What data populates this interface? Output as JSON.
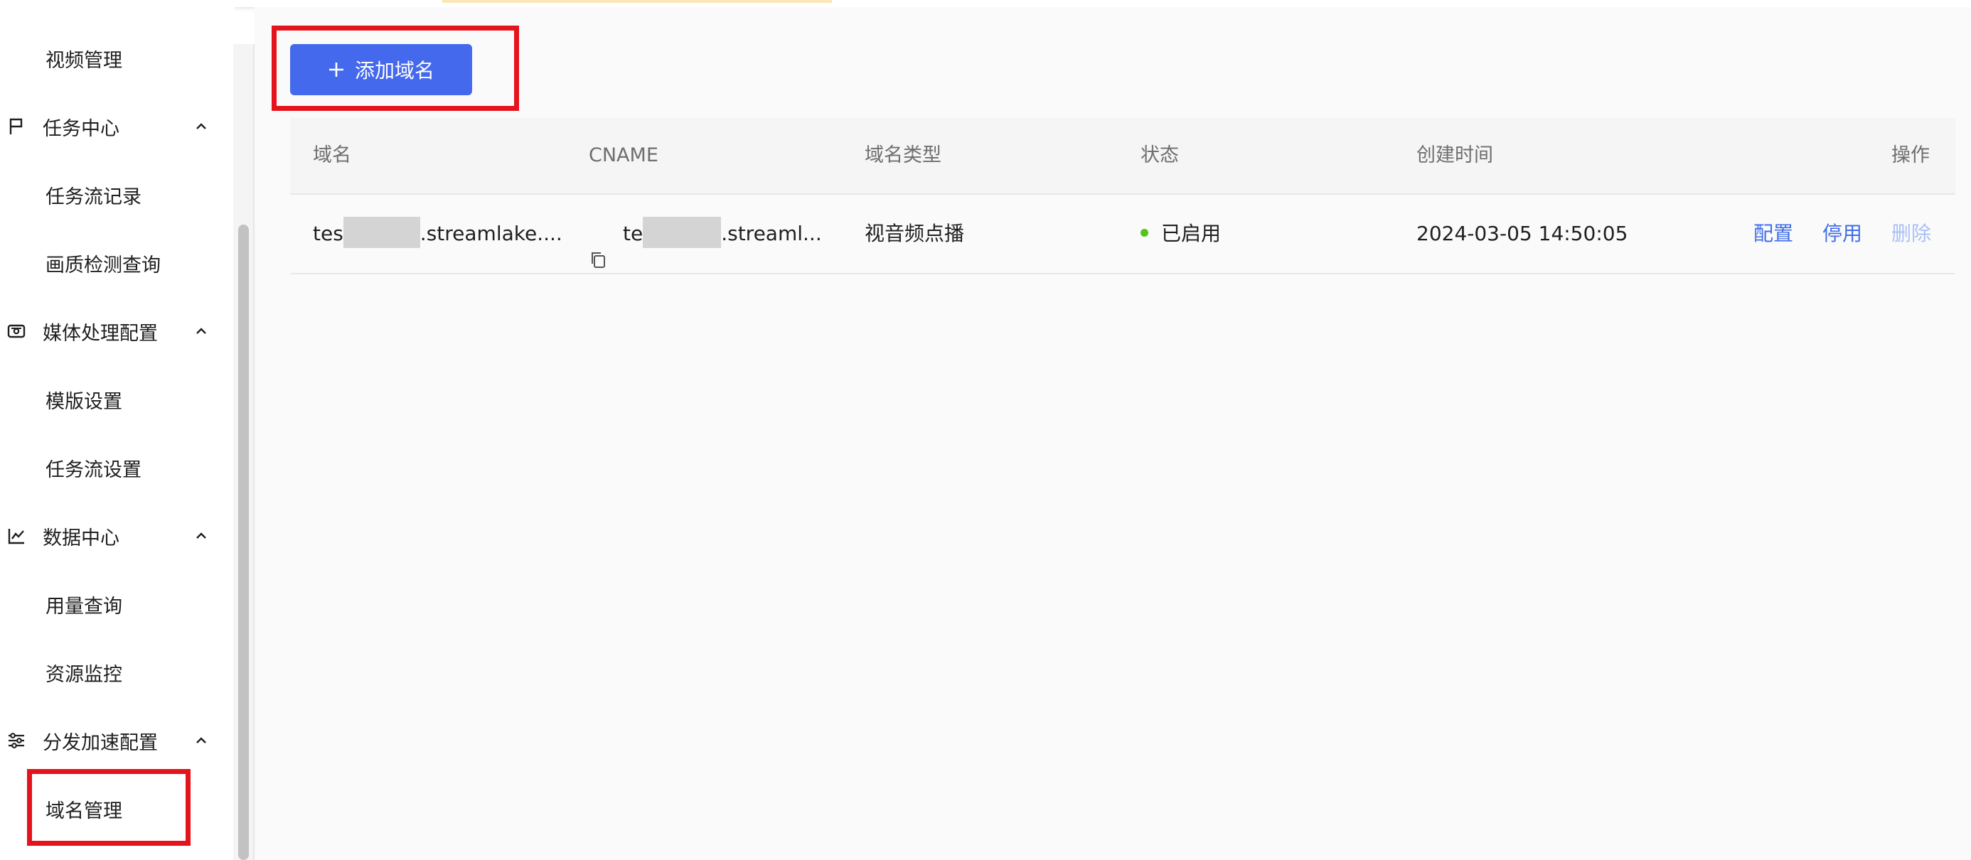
{
  "sidebar": {
    "items": [
      {
        "type": "sub",
        "label": "视频管理"
      },
      {
        "type": "group",
        "label": "任务中心",
        "icon": "flag-icon"
      },
      {
        "type": "sub",
        "label": "任务流记录"
      },
      {
        "type": "sub",
        "label": "画质检测查询"
      },
      {
        "type": "group",
        "label": "媒体处理配置",
        "icon": "media-box-icon"
      },
      {
        "type": "sub",
        "label": "模版设置"
      },
      {
        "type": "sub",
        "label": "任务流设置"
      },
      {
        "type": "group",
        "label": "数据中心",
        "icon": "line-chart-icon"
      },
      {
        "type": "sub",
        "label": "用量查询"
      },
      {
        "type": "sub",
        "label": "资源监控"
      },
      {
        "type": "group",
        "label": "分发加速配置",
        "icon": "sliders-icon"
      },
      {
        "type": "sub",
        "label": "域名管理",
        "active": true
      }
    ]
  },
  "toolbar": {
    "add_label": "添加域名",
    "add_icon": "plus-icon"
  },
  "table": {
    "columns": [
      "域名",
      "CNAME",
      "域名类型",
      "状态",
      "创建时间",
      "操作"
    ],
    "rows": [
      {
        "domain_prefix": "tes",
        "domain_suffix": ".streamlake....",
        "cname_prefix": "te",
        "cname_suffix": ".streaml...",
        "type": "视音频点播",
        "status": "已启用",
        "created": "2024-03-05 14:50:05",
        "actions": {
          "config": "配置",
          "disable": "停用",
          "delete": "删除"
        }
      }
    ]
  },
  "colors": {
    "primary": "#4469ed",
    "link": "#3f6ee8",
    "link_disabled": "#a9c0f6",
    "status_enabled": "#52c41a",
    "highlight_box": "#e5131b"
  }
}
